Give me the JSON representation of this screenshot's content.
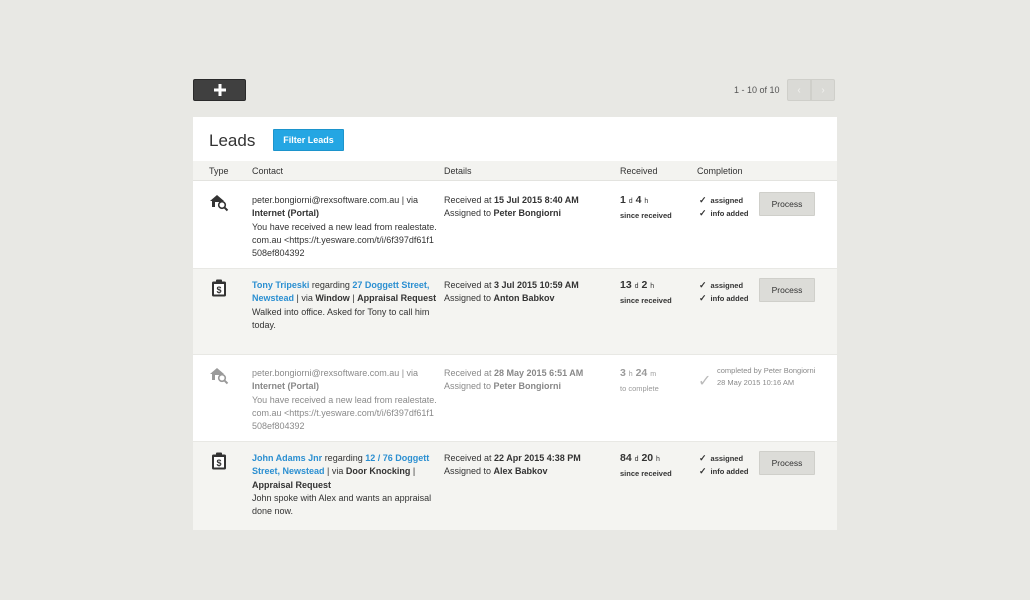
{
  "toolbar": {
    "add_label": "+"
  },
  "pagination": {
    "text": "1 - 10 of 10",
    "prev_glyph": "‹",
    "next_glyph": "›"
  },
  "panel": {
    "title": "Leads",
    "filter_label": "Filter Leads"
  },
  "columns": {
    "type": "Type",
    "contact": "Contact",
    "details": "Details",
    "received": "Received",
    "completion": "Completion"
  },
  "rows": [
    {
      "type_icon": "house-search-icon",
      "contact": {
        "email": "peter.bongiorni@rexsoftware.com.au",
        "sep1": " | via ",
        "via": "Internet (Portal)",
        "message": "You have received a new lead from realestate.com.au <https://t.yesware.com/t/i/6f397df61f1508ef804392"
      },
      "details": {
        "received_prefix": "Received at ",
        "received_at": "15 Jul 2015 8:40 AM",
        "assigned_prefix": "Assigned to ",
        "assigned_to": "Peter Bongiorni"
      },
      "elapsed": {
        "n1": "1",
        "u1": "d",
        "n2": "4",
        "u2": "h",
        "caption": "since received"
      },
      "completion": {
        "items": [
          "assigned",
          "info added"
        ],
        "check": "✓"
      },
      "process_label": "Process"
    },
    {
      "type_icon": "clipboard-dollar-icon",
      "contact": {
        "name": "Tony Tripeski",
        "regarding": " regarding ",
        "property": "27 Doggett Street, Newstead",
        "sep1": " | via ",
        "via": "Window",
        "sep2": " | ",
        "request": "Appraisal Request",
        "message": "Walked into office. Asked for Tony to call him today."
      },
      "details": {
        "received_prefix": "Received at ",
        "received_at": "3 Jul 2015 10:59 AM",
        "assigned_prefix": "Assigned to ",
        "assigned_to": "Anton Babkov"
      },
      "elapsed": {
        "n1": "13",
        "u1": "d",
        "n2": "2",
        "u2": "h",
        "caption": "since received"
      },
      "completion": {
        "items": [
          "assigned",
          "info added"
        ],
        "check": "✓"
      },
      "process_label": "Process"
    },
    {
      "type_icon": "house-search-icon",
      "contact": {
        "email": "peter.bongiorni@rexsoftware.com.au",
        "sep1": " | via ",
        "via": "Internet (Portal)",
        "message": "You have received a new lead from realestate.com.au <https://t.yesware.com/t/i/6f397df61f1508ef804392"
      },
      "details": {
        "received_prefix": "Received at ",
        "received_at": "28 May 2015 6:51 AM",
        "assigned_prefix": "Assigned to ",
        "assigned_to": "Peter Bongiorni"
      },
      "elapsed": {
        "n1": "3",
        "u1": "h",
        "n2": "24",
        "u2": "m",
        "caption": "to complete"
      },
      "completion": {
        "completed_by": "completed by Peter Bongiorni",
        "completed_at": "28 May 2015 10:16 AM",
        "check": "✓"
      }
    },
    {
      "type_icon": "clipboard-dollar-icon",
      "contact": {
        "name": "John Adams Jnr",
        "regarding": " regarding ",
        "property": "12 / 76 Doggett Street, Newstead",
        "sep1": " | via ",
        "via": "Door Knocking",
        "sep2": " | ",
        "request": "Appraisal Request",
        "message": "John spoke with Alex and wants an appraisal done now."
      },
      "details": {
        "received_prefix": "Received at ",
        "received_at": "22 Apr 2015 4:38 PM",
        "assigned_prefix": "Assigned to ",
        "assigned_to": "Alex Babkov"
      },
      "elapsed": {
        "n1": "84",
        "u1": "d",
        "n2": "20",
        "u2": "h",
        "caption": "since received"
      },
      "completion": {
        "items": [
          "assigned",
          "info added"
        ],
        "check": "✓"
      },
      "process_label": "Process"
    }
  ],
  "colors": {
    "accent": "#24a6e3",
    "link": "#2b8fd1",
    "background": "#e8e8e4",
    "alt_row": "#f4f4f1"
  }
}
